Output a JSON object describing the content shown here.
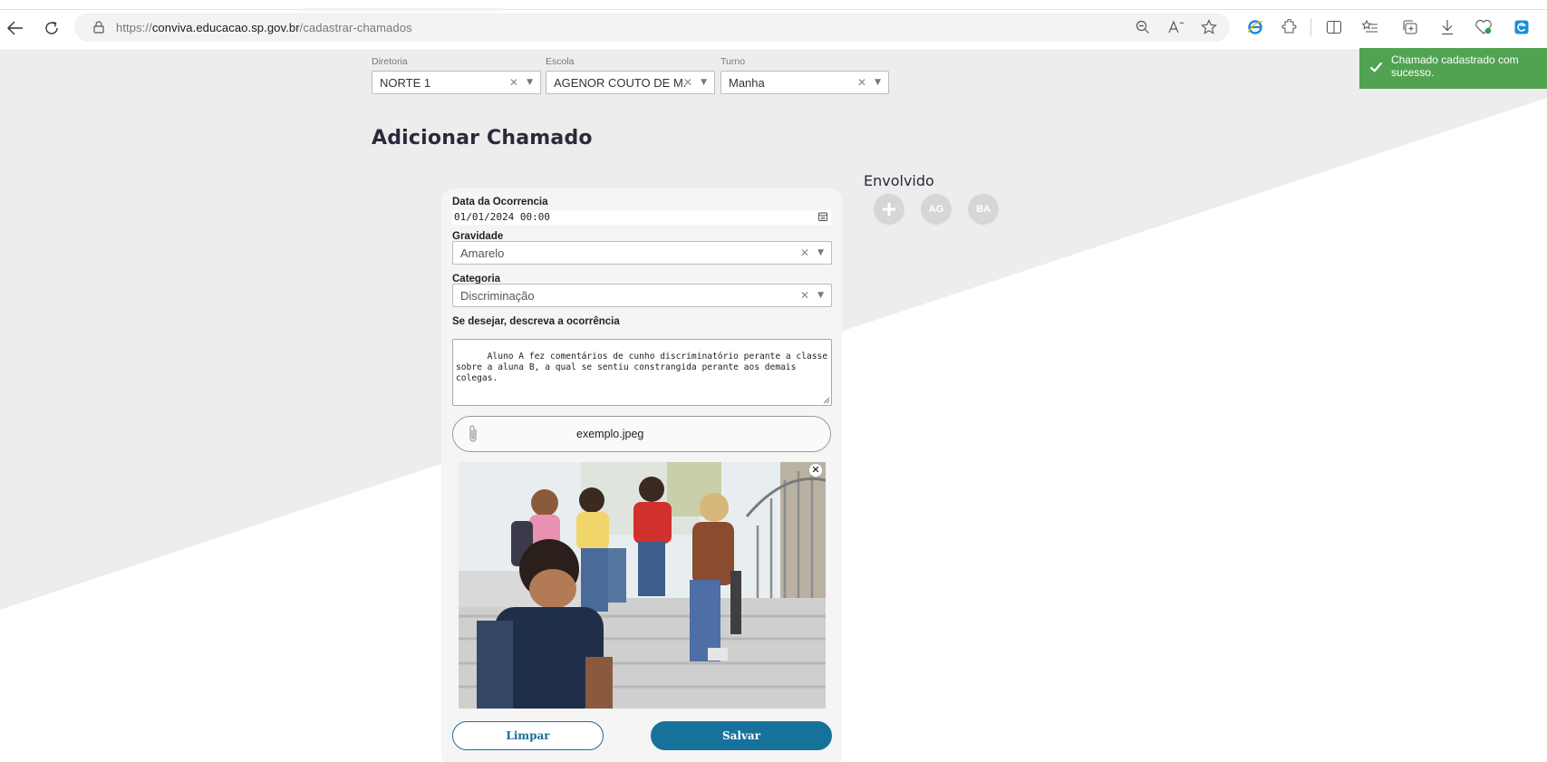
{
  "browser": {
    "url_scheme": "https://",
    "url_host": "conviva.educacao.sp.gov.br",
    "url_path": "/cadastrar-chamados"
  },
  "filters": [
    {
      "label": "Diretoria",
      "value": "NORTE 1"
    },
    {
      "label": "Escola",
      "value": "AGENOR COUTO DE M..."
    },
    {
      "label": "Turno",
      "value": "Manha"
    }
  ],
  "page": {
    "title": "Adicionar Chamado"
  },
  "form": {
    "date_label": "Data da Ocorrencia",
    "date_value": "01/01/2024 00:00",
    "gravidade_label": "Gravidade",
    "gravidade_value": "Amarelo",
    "categoria_label": "Categoria",
    "categoria_value": "Discriminação",
    "descricao_label": "Se desejar, descreva a ocorrência",
    "descricao_value": "Aluno A fez comentários de cunho discriminatório perante a classe sobre a aluna B, a qual se sentiu constrangida perante aos demais colegas.",
    "file_name": "exemplo.jpeg",
    "limpar_label": "Limpar",
    "salvar_label": "Salvar"
  },
  "envolvido": {
    "title": "Envolvido",
    "avatars": [
      "AG",
      "BA"
    ]
  },
  "toast": {
    "message": "Chamado cadastrado com sucesso."
  },
  "colors": {
    "primary": "#17729b",
    "toast_success": "#51a351",
    "page_band": "#ededed"
  }
}
